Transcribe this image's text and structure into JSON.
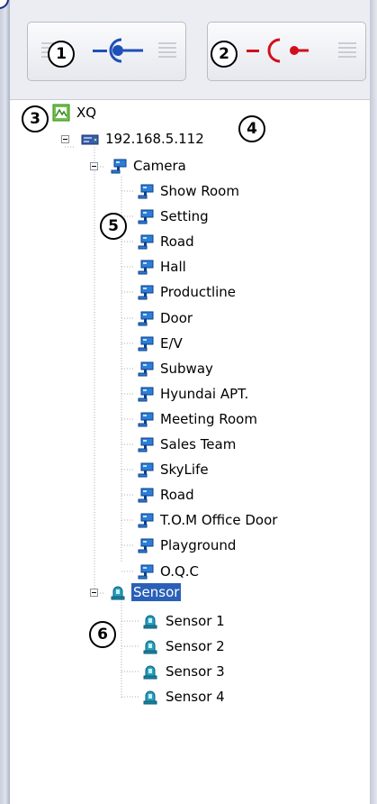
{
  "toolbar": {
    "connect_label": "",
    "disconnect_label": ""
  },
  "callouts": [
    "1",
    "2",
    "3",
    "4",
    "5",
    "6"
  ],
  "tree": {
    "root": {
      "label": "XQ"
    },
    "server": {
      "label": "192.168.5.112"
    },
    "camera_group": {
      "label": "Camera",
      "items": [
        "Show Room",
        "Setting",
        "Road",
        "Hall",
        "Productline",
        "Door",
        "E/V",
        "Subway",
        "Hyundai APT.",
        "Meeting Room",
        "Sales Team",
        "SkyLife",
        "Road",
        "T.O.M Office Door",
        "Playground",
        "O.Q.C"
      ]
    },
    "sensor_group": {
      "label": "Sensor",
      "selected": true,
      "items": [
        "Sensor 1",
        "Sensor 2",
        "Sensor 3",
        "Sensor 4"
      ]
    }
  },
  "colors": {
    "connect_icon": "#1f4fb8",
    "disconnect_icon": "#d2101c",
    "selection": "#2a60b8",
    "camera_icon": "#2c7ed8",
    "sensor_icon": "#2aa0c0"
  },
  "icons": {
    "root": "map-icon",
    "server": "server-icon",
    "camera": "camera-icon",
    "sensor": "sensor-icon",
    "connect": "plug-connect-icon",
    "disconnect": "plug-disconnect-icon"
  }
}
